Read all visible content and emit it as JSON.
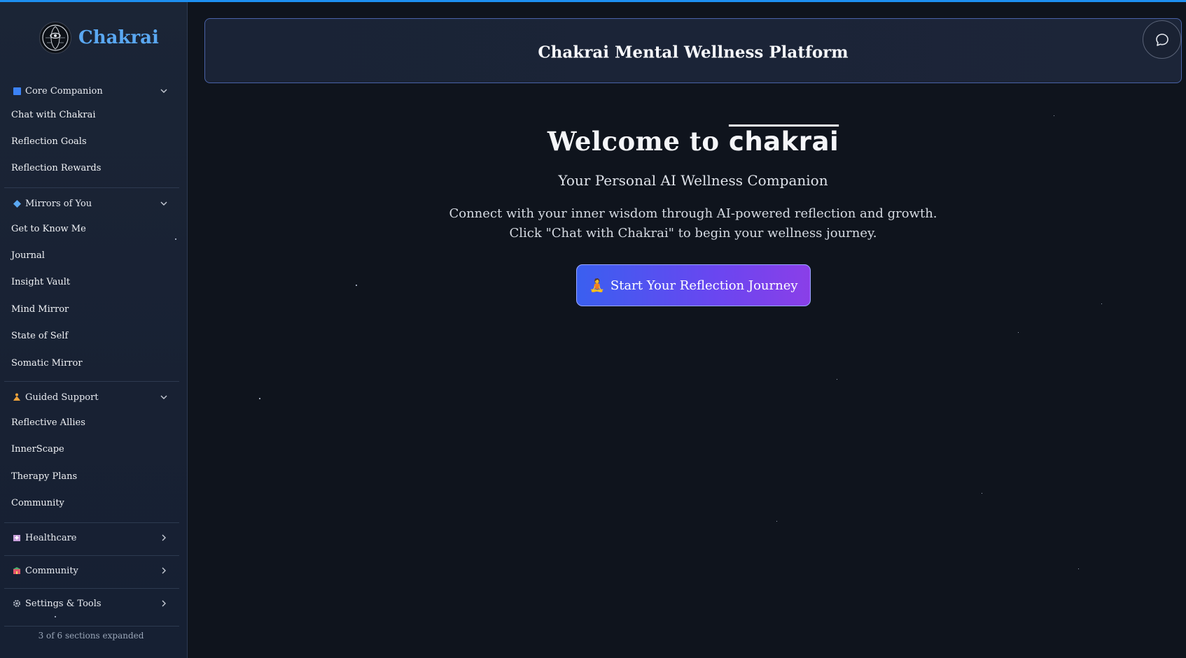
{
  "app": {
    "name": "Chakrai"
  },
  "sidebar": {
    "sections": [
      {
        "label": "Core Companion",
        "icon": "blue-square-icon",
        "expanded": true,
        "items": [
          "Chat with Chakrai",
          "Reflection Goals",
          "Reflection Rewards"
        ]
      },
      {
        "label": "Mirrors of You",
        "icon": "blue-diamond-icon",
        "expanded": true,
        "items": [
          "Get to Know Me",
          "Journal",
          "Insight Vault",
          "Mind Mirror",
          "State of Self",
          "Somatic Mirror"
        ]
      },
      {
        "label": "Guided Support",
        "icon": "meditation-icon",
        "expanded": true,
        "items": [
          "Reflective Allies",
          "InnerScape",
          "Therapy Plans",
          "Community"
        ]
      },
      {
        "label": "Healthcare",
        "icon": "hospital-icon",
        "expanded": false,
        "items": []
      },
      {
        "label": "Community",
        "icon": "community-icon",
        "expanded": false,
        "items": []
      },
      {
        "label": "Settings & Tools",
        "icon": "gear-icon",
        "expanded": false,
        "items": []
      }
    ],
    "footer": "3 of 6 sections expanded"
  },
  "header": {
    "title": "Chakrai Mental Wellness Platform"
  },
  "main": {
    "welcome_prefix": "Welcome to",
    "welcome_brand": "chakrai",
    "subtitle": "Your Personal AI Wellness Companion",
    "description": "Connect with your inner wisdom through AI-powered reflection and growth. Click \"Chat with Chakrai\" to begin your wellness journey.",
    "cta_label": "Start Your Reflection Journey",
    "cta_icon": "🧘"
  },
  "colors": {
    "accent": "#5aa8f2",
    "background": "#0f141d",
    "sidebar": "#1b2536",
    "cta_start": "#3a5ff0",
    "cta_end": "#8a3fe8"
  }
}
